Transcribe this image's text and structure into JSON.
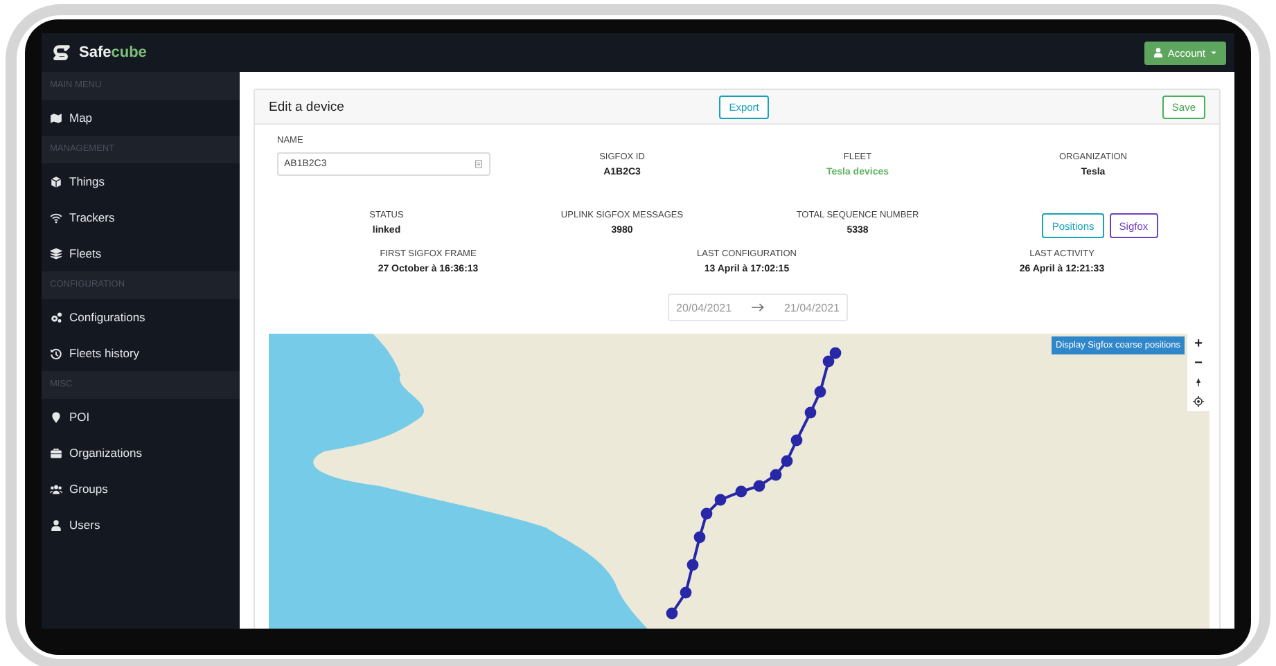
{
  "brand": {
    "text": "Safe",
    "accent": "cube"
  },
  "account": {
    "label": "Account"
  },
  "sidebar": {
    "sections": [
      {
        "title": "MAIN MENU",
        "items": [
          {
            "label": "Map"
          }
        ]
      },
      {
        "title": "MANAGEMENT",
        "items": [
          {
            "label": "Things"
          },
          {
            "label": "Trackers"
          },
          {
            "label": "Fleets"
          }
        ]
      },
      {
        "title": "CONFIGURATION",
        "items": [
          {
            "label": "Configurations"
          },
          {
            "label": "Fleets history"
          }
        ]
      },
      {
        "title": "MISC",
        "items": [
          {
            "label": "POI"
          },
          {
            "label": "Organizations"
          },
          {
            "label": "Groups"
          },
          {
            "label": "Users"
          }
        ]
      }
    ]
  },
  "card": {
    "title": "Edit a device",
    "export_button": "Export",
    "save_button": "Save",
    "name_field": {
      "label": "NAME",
      "value": "AB1B2C3"
    },
    "row_1": [
      {
        "label": "SIGFOX ID",
        "value": "A1B2C3",
        "kind": "text"
      },
      {
        "label": "FLEET",
        "value": "Tesla devices",
        "kind": "link"
      },
      {
        "label": "ORGANIZATION",
        "value": "Tesla",
        "kind": "text"
      }
    ],
    "row_2": [
      {
        "label": "STATUS",
        "value": "linked",
        "kind": "text"
      },
      {
        "label": "UPLINK SIGFOX MESSAGES",
        "value": "3980",
        "kind": "text"
      },
      {
        "label": "TOTAL SEQUENCE NUMBER",
        "value": "5338",
        "kind": "text"
      }
    ],
    "view_buttons": [
      {
        "label": "Positions",
        "color": "#17a2b8"
      },
      {
        "label": "Sigfox",
        "color": "#6f42c1"
      }
    ],
    "row_3": [
      {
        "label": "FIRST SIGFOX FRAME",
        "value": "27 October à 16:36:13",
        "kind": "text"
      },
      {
        "label": "LAST CONFIGURATION",
        "value": "13 April à 17:02:15",
        "kind": "text"
      },
      {
        "label": "LAST ACTIVITY",
        "value": "26 April à 12:21:33",
        "kind": "text"
      }
    ],
    "date_range": {
      "start": "20/04/2021",
      "end": "21/04/2021"
    },
    "map": {
      "overlay_button": "Display Sigfox coarse positions",
      "zoom_in": "+",
      "zoom_out": "−"
    }
  }
}
